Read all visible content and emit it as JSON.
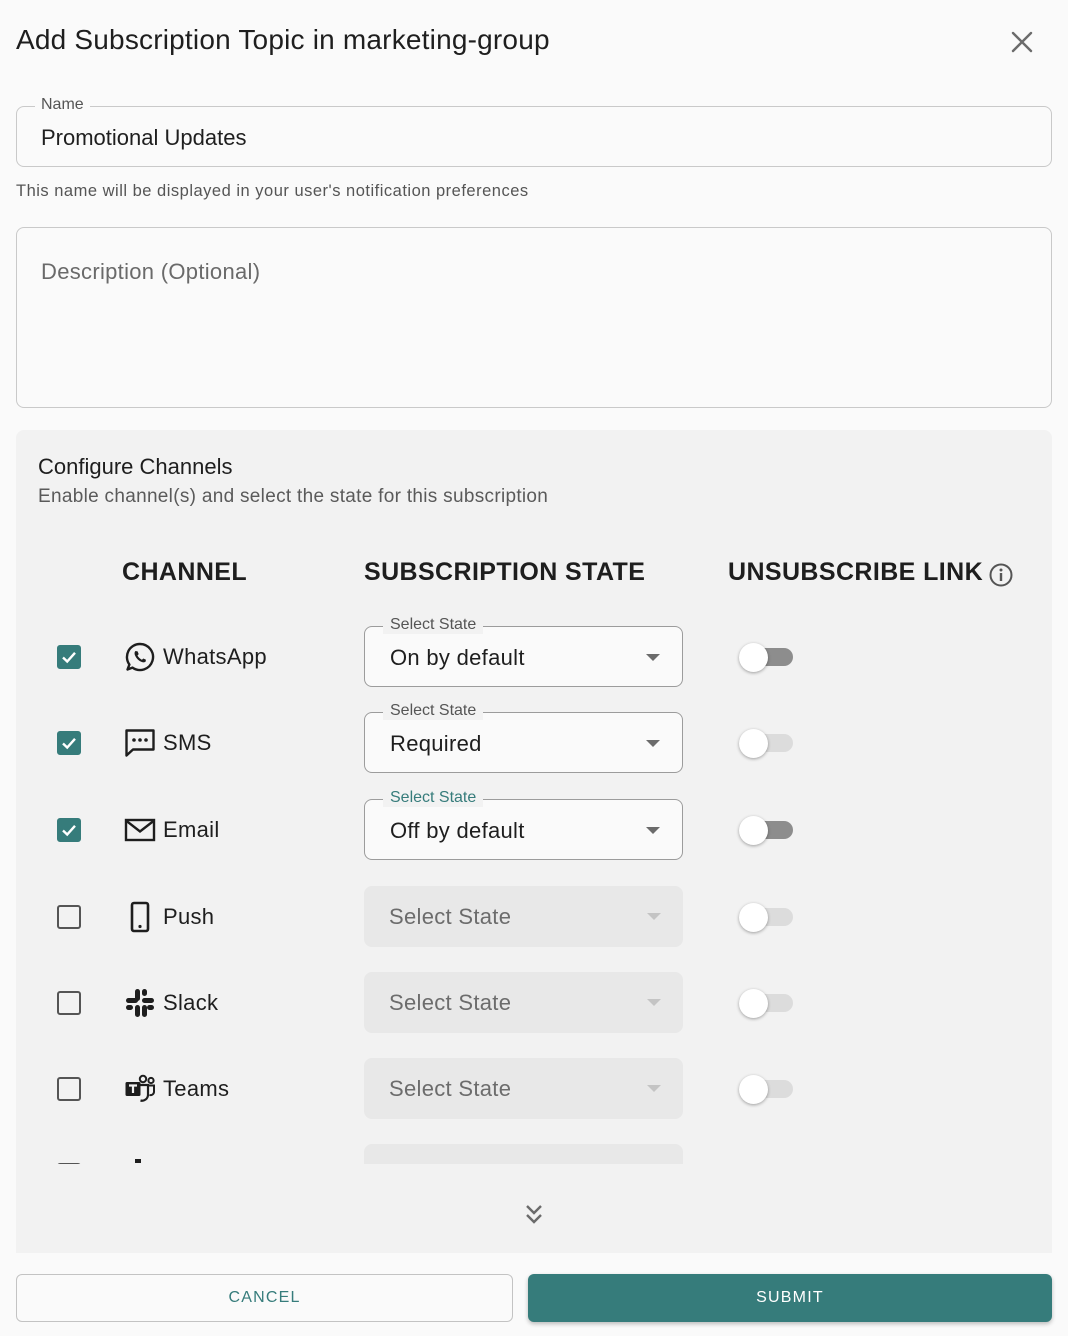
{
  "dialog": {
    "title": "Add Subscription Topic in marketing-group",
    "close_icon": "close-icon"
  },
  "name_field": {
    "label": "Name",
    "value": "Promotional Updates",
    "helper": "This name will be displayed in your user's notification preferences"
  },
  "description_field": {
    "placeholder": "Description (Optional)",
    "value": ""
  },
  "channels": {
    "title": "Configure Channels",
    "subtitle": "Enable channel(s) and select the state for this subscription",
    "columns": {
      "channel": "CHANNEL",
      "state": "SUBSCRIPTION STATE",
      "unsubscribe": "UNSUBSCRIBE LINK"
    },
    "rows": [
      {
        "name": "WhatsApp",
        "icon": "whatsapp-icon",
        "checked": true,
        "state_label": "Select State",
        "state": "On by default",
        "enabled": true,
        "focused": false,
        "toggle_on": false
      },
      {
        "name": "SMS",
        "icon": "sms-icon",
        "checked": true,
        "state_label": "Select State",
        "state": "Required",
        "enabled": true,
        "focused": false,
        "toggle_on": false
      },
      {
        "name": "Email",
        "icon": "email-icon",
        "checked": true,
        "state_label": "Select State",
        "state": "Off by default",
        "enabled": true,
        "focused": true,
        "toggle_on": false
      },
      {
        "name": "Push",
        "icon": "push-icon",
        "checked": false,
        "state_label": "",
        "state": "Select State",
        "enabled": false,
        "focused": false,
        "toggle_on": false
      },
      {
        "name": "Slack",
        "icon": "slack-icon",
        "checked": false,
        "state_label": "",
        "state": "Select State",
        "enabled": false,
        "focused": false,
        "toggle_on": false
      },
      {
        "name": "Teams",
        "icon": "teams-icon",
        "checked": false,
        "state_label": "",
        "state": "Select State",
        "enabled": false,
        "focused": false,
        "toggle_on": false
      }
    ],
    "scroll_more_icon": "chevron-double-down-icon"
  },
  "footer": {
    "cancel_label": "CANCEL",
    "submit_label": "SUBMIT"
  },
  "colors": {
    "accent": "#367c7b",
    "panel": "#f2f2f2",
    "background": "#fafafa"
  }
}
